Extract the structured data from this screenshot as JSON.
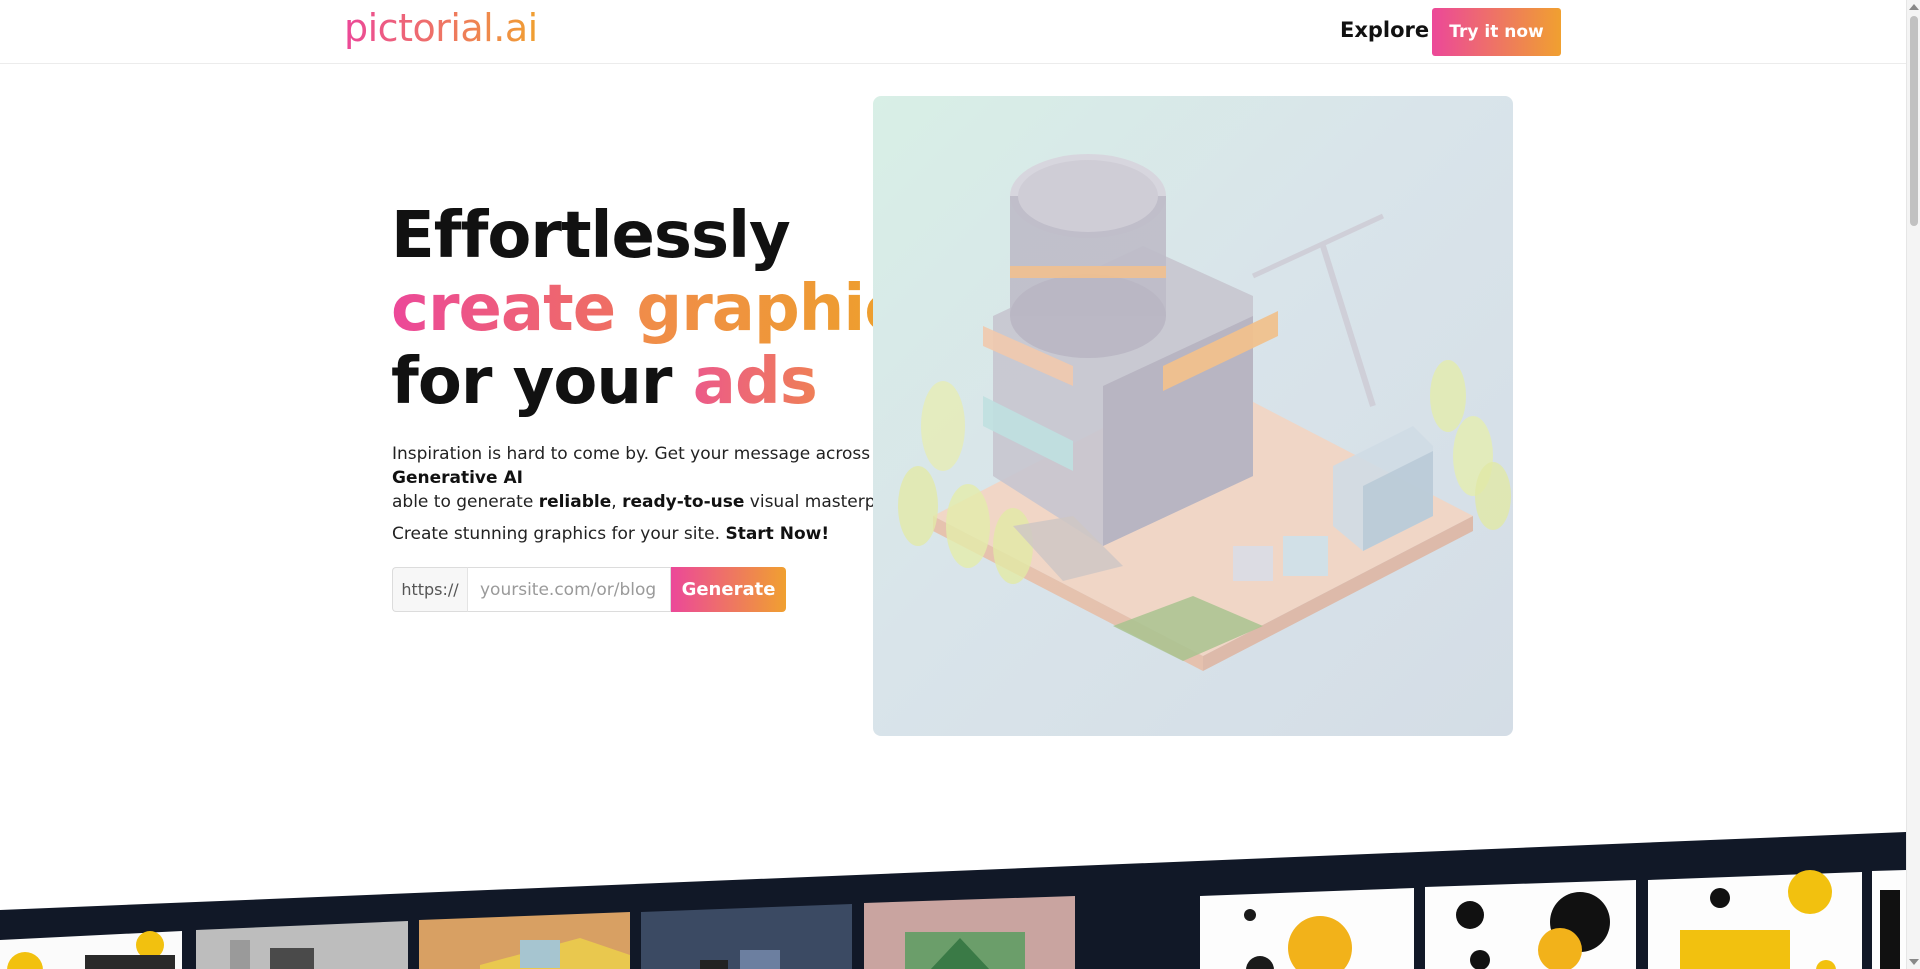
{
  "header": {
    "logo": "pictorial.ai",
    "nav_explore": "Explore",
    "cta_button": "Try it now"
  },
  "hero": {
    "headline": {
      "line1": "Effortlessly",
      "line2_part1": "create",
      "line2_part2": "graphics",
      "line3_part1": "for your",
      "line3_part2": "ads"
    },
    "description": {
      "text1": "Inspiration is hard to come by. Get your message across hustle-free by leveraging a ",
      "bold1": "Generative AI",
      "text2": " able to generate ",
      "bold2": "reliable",
      "text3": ", ",
      "bold3": "ready-to-use",
      "text4": " visual masterpieces."
    },
    "cta": {
      "text": "Create stunning graphics for your site. ",
      "bold": "Start Now!"
    },
    "form": {
      "prefix": "https://",
      "placeholder": "yoursite.com/or/blog",
      "value": "",
      "button": "Generate"
    },
    "image_icon": "isometric-building-illustration"
  },
  "gallery": {
    "items": [
      "yellow-splash-monitor",
      "isometric-office",
      "isometric-desk-yellow",
      "isometric-room-dark",
      "isometric-monitor-trees",
      "abstract-yellow-black-1",
      "abstract-yellow-black-2",
      "abstract-yellow-black-3"
    ]
  },
  "colors": {
    "gradient_start": "#ec4899",
    "gradient_end": "#f0a030",
    "band_dark": "#111827"
  }
}
